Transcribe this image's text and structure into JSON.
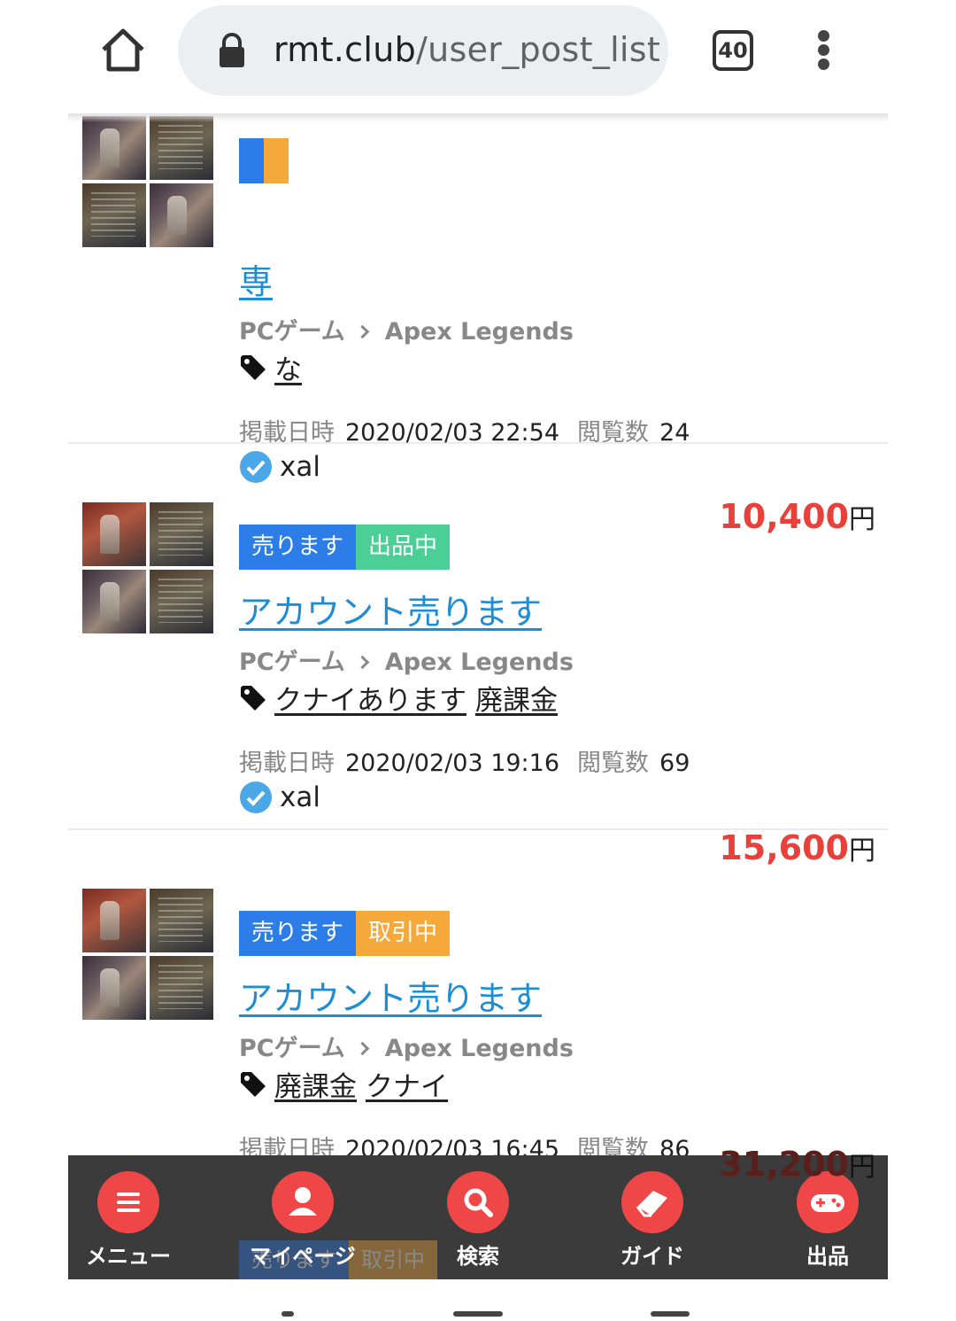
{
  "browser": {
    "url_host": "rmt.club",
    "url_path": "/user_post_list",
    "tab_count": "40"
  },
  "posts": [
    {
      "badge_type": "",
      "badge_status": "",
      "title": "専",
      "category": "PCゲーム",
      "game": "Apex Legends",
      "tags": [
        "な"
      ],
      "posted_label": "掲載日時",
      "posted_at": "2020/02/03 22:54",
      "views_label": "閲覧数",
      "views": "24",
      "seller": "xal",
      "price": "10,400",
      "currency": "円"
    },
    {
      "badge_type": "売ります",
      "badge_status": "出品中",
      "title": "アカウント売ります",
      "category": "PCゲーム",
      "game": "Apex Legends",
      "tags": [
        "クナイあります",
        "廃課金"
      ],
      "posted_label": "掲載日時",
      "posted_at": "2020/02/03 19:16",
      "views_label": "閲覧数",
      "views": "69",
      "seller": "xal",
      "price": "15,600",
      "currency": "円"
    },
    {
      "badge_type": "売ります",
      "badge_status": "取引中",
      "title": "アカウント売ります",
      "category": "PCゲーム",
      "game": "Apex Legends",
      "tags": [
        "廃課金",
        "クナイ"
      ],
      "posted_label": "掲載日時",
      "posted_at": "2020/02/03 16:45",
      "views_label": "閲覧数",
      "views": "86",
      "seller": "xal",
      "price": "31,200",
      "currency": "円"
    }
  ],
  "next_post_peek": {
    "badge_type": "売ります",
    "badge_status": "取引中"
  },
  "bottom_nav": {
    "menu": "メニュー",
    "mypage": "マイページ",
    "search": "検索",
    "guide": "ガイド",
    "sell": "出品"
  },
  "colors": {
    "sell_badge": "#2d7de8",
    "listed_badge": "#4ccf96",
    "trading_badge": "#f5a93b",
    "price": "#e8403a",
    "link": "#1d8ed6",
    "nav_bg": "#3b3b3b",
    "nav_icon": "#ef4747"
  }
}
